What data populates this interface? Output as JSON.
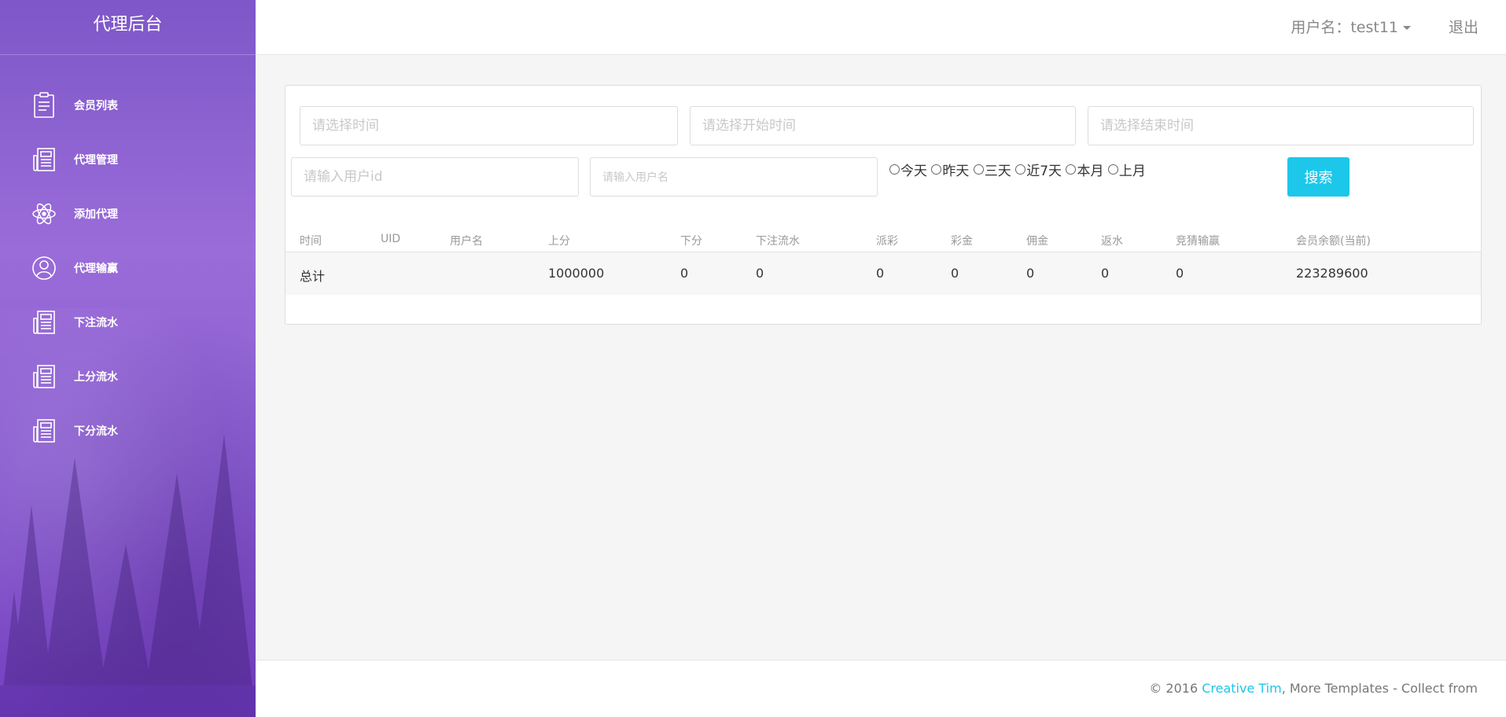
{
  "sidebar": {
    "brand": "代理后台",
    "items": [
      {
        "label": "会员列表",
        "icon": "clipboard-icon"
      },
      {
        "label": "代理管理",
        "icon": "newspaper-icon"
      },
      {
        "label": "添加代理",
        "icon": "atom-icon"
      },
      {
        "label": "代理输赢",
        "icon": "user-circle-icon"
      },
      {
        "label": "下注流水",
        "icon": "newspaper-icon"
      },
      {
        "label": "上分流水",
        "icon": "newspaper-icon"
      },
      {
        "label": "下分流水",
        "icon": "newspaper-icon"
      }
    ]
  },
  "header": {
    "user_label": "用户名：test11",
    "logout_label": "退出"
  },
  "filters": {
    "time_placeholder": "请选择时间",
    "start_placeholder": "请选择开始时间",
    "end_placeholder": "请选择结束时间",
    "userid_placeholder": "请输入用户id",
    "username_placeholder": "请输入用户名",
    "quick_ranges": [
      "今天",
      "昨天",
      "三天",
      "近7天",
      "本月",
      "上月"
    ],
    "search_label": "搜索"
  },
  "table": {
    "columns": [
      "时间",
      "UID",
      "用户名",
      "上分",
      "下分",
      "下注流水",
      "派彩",
      "彩金",
      "佣金",
      "返水",
      "竞猜输赢",
      "会员余额(当前)"
    ],
    "total_row": [
      "总计",
      "",
      "",
      "1000000",
      "0",
      "0",
      "0",
      "0",
      "0",
      "0",
      "0",
      "223289600"
    ]
  },
  "footer": {
    "prefix": "© 2016 ",
    "link": "Creative Tim",
    "suffix": ", More Templates - Collect from"
  },
  "colors": {
    "sidebar_purple": "#8a5dd0",
    "accent_cyan": "#1dc7ea"
  }
}
